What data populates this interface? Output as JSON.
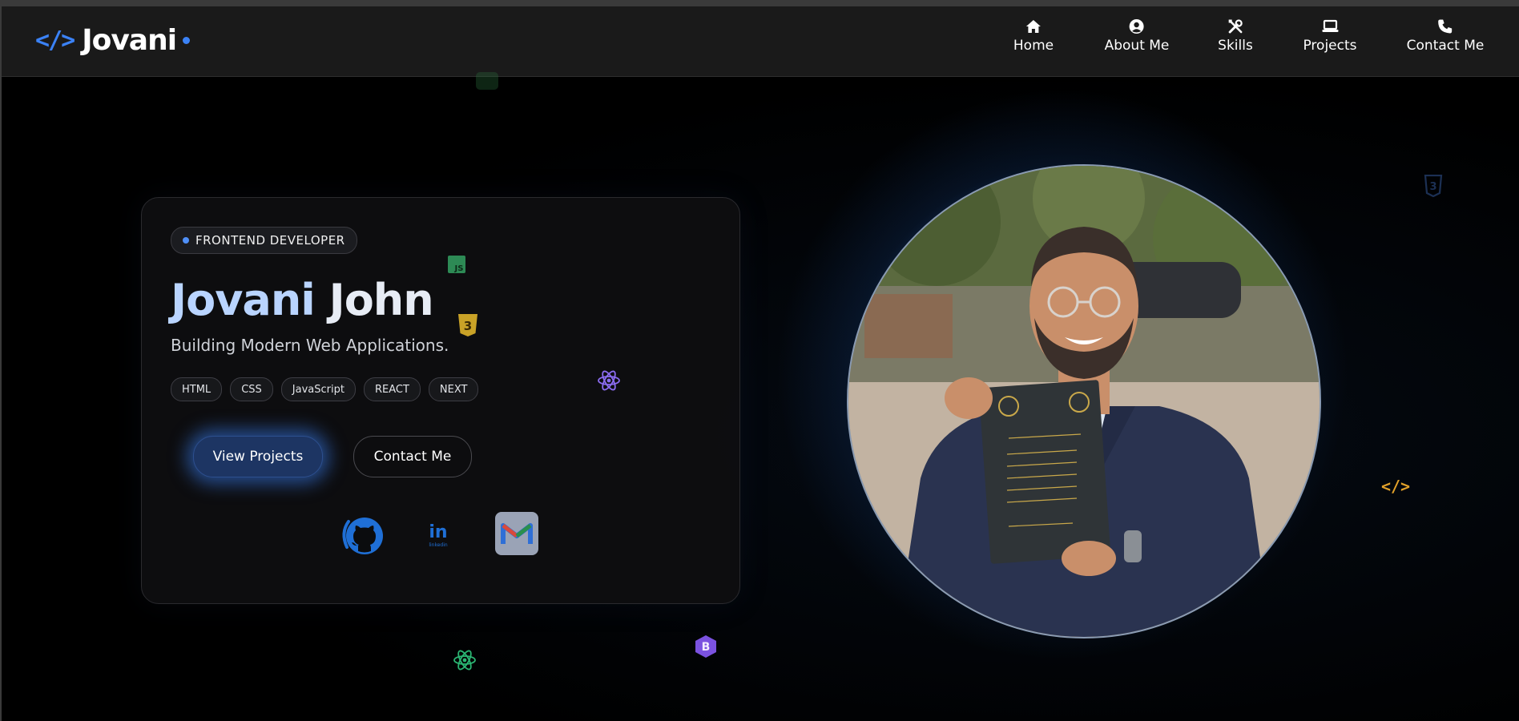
{
  "logo": {
    "mark": "</>",
    "text": "Jovani"
  },
  "nav": {
    "items": [
      {
        "label": "Home",
        "icon": "home-icon"
      },
      {
        "label": "About Me",
        "icon": "user-circle-icon"
      },
      {
        "label": "Skills",
        "icon": "tools-icon"
      },
      {
        "label": "Projects",
        "icon": "laptop-icon"
      },
      {
        "label": "Contact Me",
        "icon": "phone-icon"
      }
    ]
  },
  "hero": {
    "badge": "FRONTEND DEVELOPER",
    "name_first": "Jovani",
    "name_last": "John",
    "subtitle": "Building Modern Web Applications.",
    "tags": [
      "HTML",
      "CSS",
      "JavaScript",
      "REACT",
      "NEXT"
    ],
    "primary_button": "View Projects",
    "secondary_button": "Contact Me"
  },
  "social": {
    "github": "github-icon",
    "linkedin_text": "in",
    "linkedin_sub": "linkedin",
    "gmail": "gmail-icon"
  },
  "decorations": {
    "js_label": "JS",
    "css_label": "3",
    "bootstrap_label": "B",
    "code_label": "</>"
  },
  "colors": {
    "accent": "#3b82f6",
    "navbar_bg": "#1a1a1a",
    "page_bg": "#000000",
    "name_highlight": "#b9d4ff",
    "react_purple": "#8b6cf0",
    "react_green": "#2bb673",
    "css_gold": "#c9a227",
    "bootstrap_purple": "#7b52e0",
    "code_orange": "#e2a12a"
  }
}
